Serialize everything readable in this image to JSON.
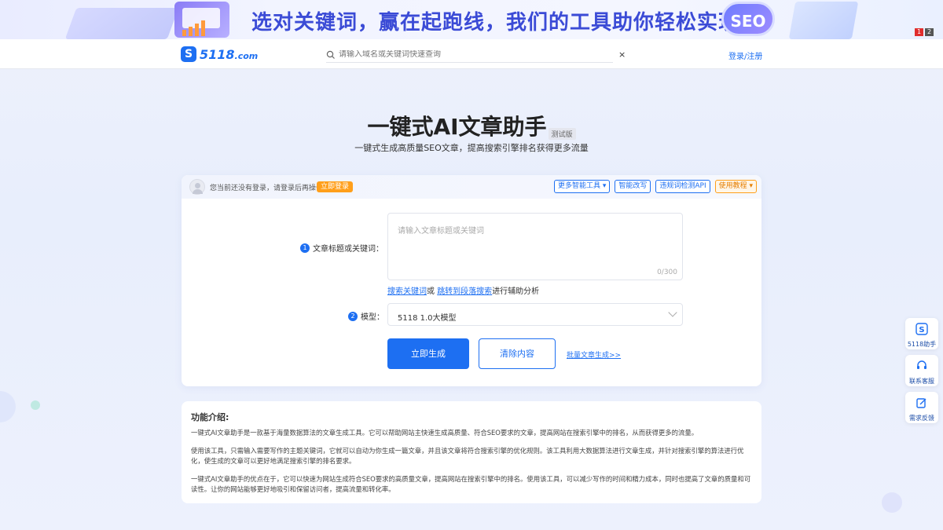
{
  "banner": {
    "headline": "选对关键词，赢在起跑线，我们的工具助你轻松实现！",
    "badge": "SEO",
    "pager": [
      "1",
      "2"
    ]
  },
  "nav": {
    "logo_text": "5118",
    "logo_suffix": ".com",
    "search_placeholder": "请输入域名或关键词快速查询",
    "clear_symbol": "×",
    "login": "登录/注册"
  },
  "hero": {
    "title": "一键式AI文章助手",
    "beta": "测试版",
    "subtitle": "一键式生成高质量SEO文章，提高搜索引擎排名获得更多流量"
  },
  "card": {
    "login_tip": "您当前还没有登录，请登录后再操作",
    "login_btn": "立即登录",
    "head_buttons": [
      {
        "label": "更多智能工具 ▾",
        "style": "blue"
      },
      {
        "label": "智能改写",
        "style": "blue"
      },
      {
        "label": "违规词检测API",
        "style": "blue"
      },
      {
        "label": "使用教程 ▾",
        "style": "orange"
      }
    ],
    "field1": {
      "num": "1",
      "label": "文章标题或关键词：",
      "placeholder": "请输入文章标题或关键词",
      "counter": "0/300"
    },
    "aux": {
      "link1": "搜索关键词",
      "or": "或",
      "link2": "跳转到段落搜索",
      "rest": "进行辅助分析"
    },
    "field2": {
      "num": "2",
      "label": "模型：",
      "value": "5118 1.0大模型"
    },
    "generate": "立即生成",
    "clear": "清除内容",
    "batch": "批量文章生成>>"
  },
  "intro": {
    "title": "功能介绍:",
    "paragraphs": [
      "一键式AI文章助手是一款基于海量数据算法的文章生成工具。它可以帮助网站主快速生成高质量、符合SEO要求的文章，提高网站在搜索引擎中的排名，从而获得更多的流量。",
      "使用该工具，只需输入需要写作的主题关键词，它就可以自动为你生成一篇文章，并且该文章将符合搜索引擎的优化规则。该工具利用大数据算法进行文章生成，并针对搜索引擎的算法进行优化，使生成的文章可以更好地满足搜索引擎的排名要求。",
      "一键式AI文章助手的优点在于，它可以快速为网站生成符合SEO要求的高质量文章，提高网站在搜索引擎中的排名。使用该工具，可以减少写作的时间和精力成本，同时也提高了文章的质量和可读性。让你的网站能够更好地吸引和保留访问者，提高流量和转化率。"
    ]
  },
  "side": {
    "assistant": "5118助手",
    "service": "联系客服",
    "feedback": "需求反馈"
  },
  "colors": {
    "primary": "#1d6ff2",
    "orange": "#ff9f1a",
    "banner_text": "#3b4bd6"
  }
}
